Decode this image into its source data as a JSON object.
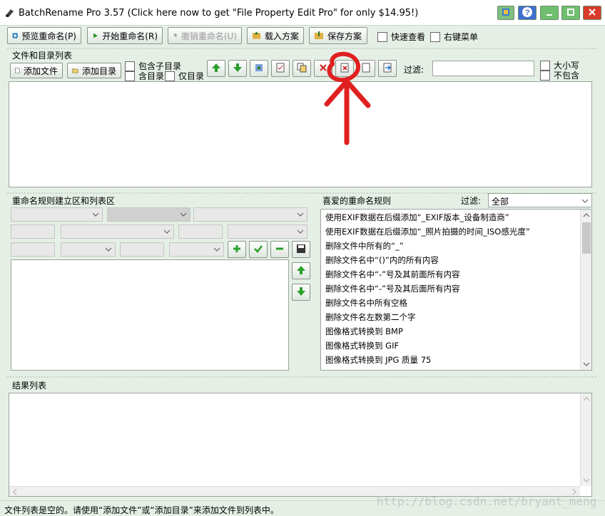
{
  "window": {
    "title": "BatchRename Pro 3.57  (Click here now to get \"File Property Edit Pro\" for only $14.95!)"
  },
  "toolbar": {
    "preview": "预览重命名(P)",
    "start": "开始重命名(R)",
    "undo": "撤销重命名(U)",
    "load": "载入方案",
    "save": "保存方案",
    "quick_view": "快速查看",
    "right_menu": "右键菜单"
  },
  "files": {
    "group_title": "文件和目录列表",
    "add_file": "添加文件",
    "add_dir": "添加目录",
    "include_sub": "包含子目录",
    "dir_only_1": "含目录",
    "dir_only_2": "仅目录",
    "filter_label": "过滤:",
    "case": "大小写",
    "exclude": "不包含"
  },
  "rules": {
    "group_title": "重命名规则建立区和列表区"
  },
  "favorites": {
    "title": "喜爱的重命名规则",
    "filter_label": "过滤:",
    "filter_value": "全部",
    "items": [
      "使用EXIF数据在后缀添加“_EXIF版本_设备制造商”",
      "使用EXIF数据在后缀添加“_照片拍摄的时间_ISO感光度”",
      "删除文件中所有的“_”",
      "删除文件名中“()”内的所有内容",
      "删除文件名中“-”号及其前面所有内容",
      "删除文件名中“-”号及其后面所有内容",
      "删除文件名中所有空格",
      "删除文件名左数第二个字",
      "图像格式转换到 BMP",
      "图像格式转换到 GIF",
      "图像格式转换到 JPG 质量 75"
    ]
  },
  "results": {
    "title": "结果列表"
  },
  "status": {
    "text": "文件列表是空的。请使用“添加文件”或“添加目录”来添加文件到列表中。",
    "watermark": "http://blog.csdn.net/bryant_meng"
  },
  "colors": {
    "background": "#e6efe6",
    "annotation": "#e02020"
  }
}
